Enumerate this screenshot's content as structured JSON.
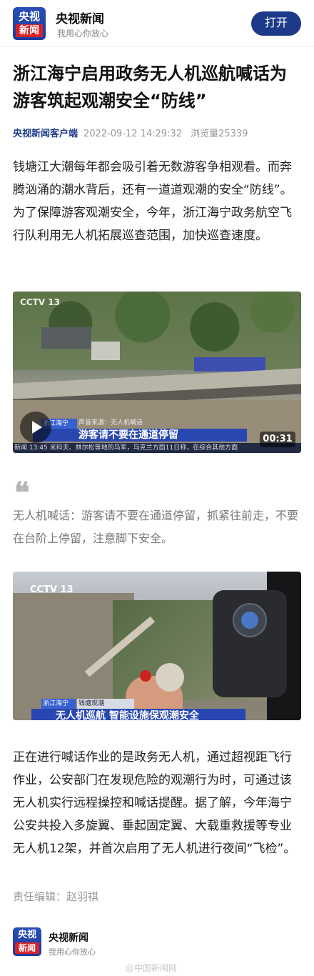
{
  "header": {
    "logo_line1": "央视",
    "logo_line2": "新闻",
    "brand_name": "央视新闻",
    "slogan": "我用心你放心",
    "open_button": "打开"
  },
  "article": {
    "title": "浙江海宁启用政务无人机巡航喊话为游客筑起观潮安全“防线”",
    "source": "央视新闻客户端",
    "datetime": "2022-09-12 14:29:32",
    "views": "浏览量25339",
    "para1": "钱塘江大潮每年都会吸引着无数游客争相观看。而奔腾汹涌的潮水背后，还有一道道观潮的安全“防线”。为了保障游客观潮安全，今年，浙江海宁政务航空飞行队利用无人机拓展巡查范围，加快巡查速度。",
    "quote_mark": "❝",
    "quote": "无人机喊话：游客请不要在通道停留，抓紧往前走，不要在台阶上停留，注意脚下安全。",
    "para2": "正在进行喊话作业的是政务无人机，通过超视距飞行作业，公安部门在发现危险的观潮行为时，可通过该无人机实行远程操控和喊话提醒。据了解，今年海宁公安共投入多旋翼、垂起固定翼、大载重救援等专业无人机12架，并首次启用了无人机进行夜间“飞检”。",
    "editor": "责任编辑：赵羽祺"
  },
  "video": {
    "channel": "CCTV 13",
    "location": "浙江海宁",
    "subtitle": "声音来源：无人机喊话",
    "caption": "游客请不要在通道停留",
    "ticker": "新闻 13:45 米科夫、林尔松等地的乌军，乌克兰方面11日称，在综合其他方面",
    "duration": "00:31"
  },
  "image2": {
    "channel": "CCTV 13",
    "location": "浙江海宁",
    "tag": "钱塘观潮",
    "caption": "无人机巡航 智能设施保观潮安全"
  },
  "footer": {
    "logo_line1": "央视",
    "logo_line2": "新闻",
    "brand_name": "央视新闻",
    "slogan": "我用心你放心",
    "watermark": "@中国新闻网"
  },
  "colors": {
    "brand_blue": "#1d3a8a",
    "brand_red": "#d6232a"
  }
}
